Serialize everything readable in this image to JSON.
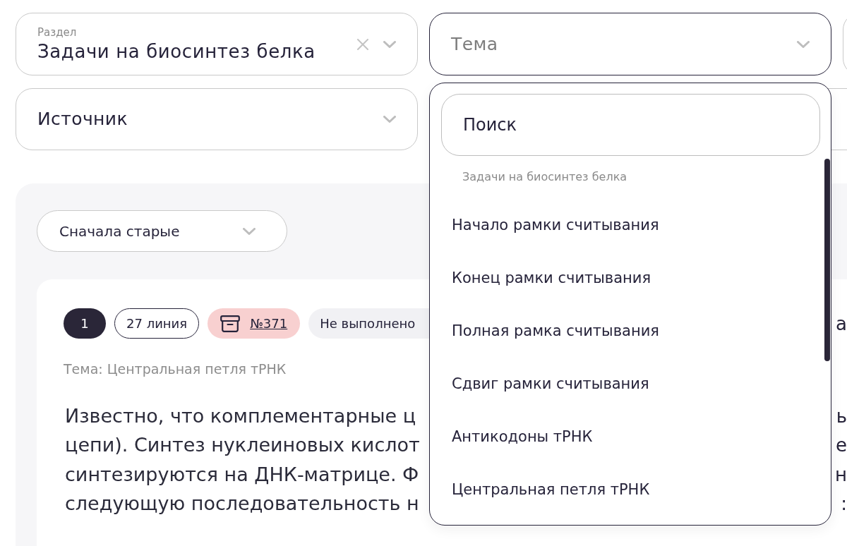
{
  "filter_rows": [
    [
      {
        "kind": "select",
        "label": "Раздел",
        "value": "Задачи на биосинтез белка",
        "clearable": true,
        "open": false
      },
      {
        "kind": "select",
        "placeholder": "Тема",
        "clearable": false,
        "open": true
      },
      {
        "kind": "blank"
      }
    ],
    [
      {
        "kind": "select",
        "placeholder": "Источник",
        "clearable": false,
        "open": false
      },
      {
        "kind": "blank"
      }
    ]
  ],
  "dropdown": {
    "search": {
      "placeholder": "Поиск"
    },
    "group_label": "Задачи на биосинтез белка",
    "options": [
      {
        "label": "Начало рамки считывания",
        "selected": false
      },
      {
        "label": "Конец рамки считывания",
        "selected": false
      },
      {
        "label": "Полная рамка считывания",
        "selected": false
      },
      {
        "label": "Сдвиг рамки считывания",
        "selected": false
      },
      {
        "label": "Антикодоны тРНК",
        "selected": false
      },
      {
        "label": "Центральная петля тРНК",
        "selected": false
      }
    ]
  },
  "sort": {
    "label": "Сначала старые"
  },
  "task": {
    "badges": [
      {
        "kind": "number",
        "text": "1"
      },
      {
        "kind": "outline",
        "text": "27 линия"
      },
      {
        "kind": "link",
        "text": "№371"
      },
      {
        "kind": "status",
        "text": "Не выполнено"
      }
    ],
    "badge_row_fragment": "а",
    "topic": "Тема: Центральная петля тРНК",
    "text_lines": [
      {
        "left": "Известно, что комплементарные ц",
        "right": "ь"
      },
      {
        "left": "цепи). Синтез нуклеиновых кислот",
        "right": "е"
      },
      {
        "left": "синтезируются на ДНК-матрице. Ф",
        "right": "н"
      },
      {
        "left": "следующую последовательность н",
        "right": ":"
      }
    ]
  }
}
